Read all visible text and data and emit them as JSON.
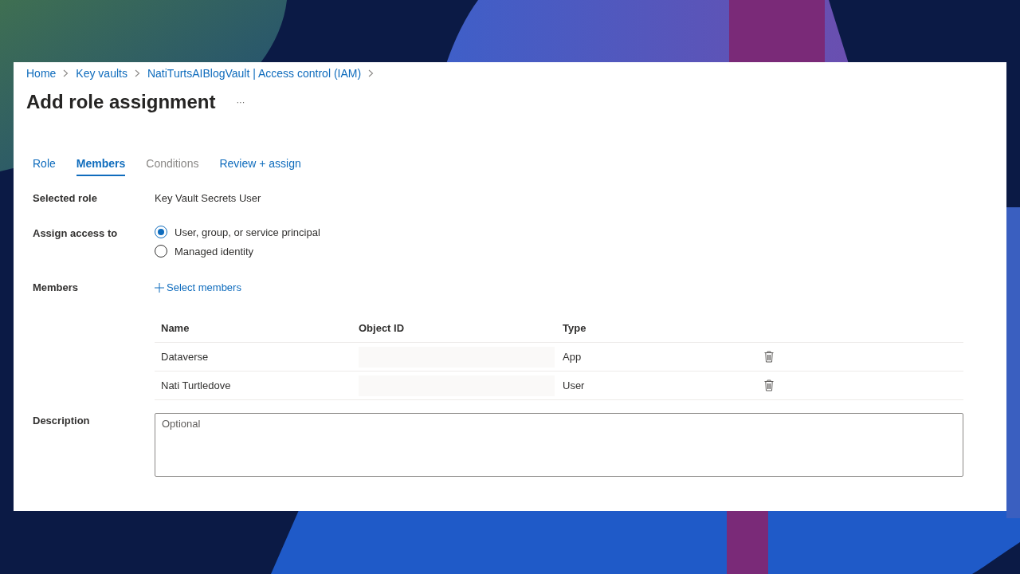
{
  "breadcrumb": [
    {
      "label": "Home"
    },
    {
      "label": "Key vaults"
    },
    {
      "label": "NatiTurtsAIBlogVault | Access control (IAM)"
    }
  ],
  "title": "Add role assignment",
  "more_button": "···",
  "tabs": [
    {
      "label": "Role",
      "selected": false,
      "disabled": false
    },
    {
      "label": "Members",
      "selected": true,
      "disabled": false
    },
    {
      "label": "Conditions",
      "selected": false,
      "disabled": true
    },
    {
      "label": "Review + assign",
      "selected": false,
      "disabled": false
    }
  ],
  "selected_role": {
    "label": "Selected role",
    "value": "Key Vault Secrets User"
  },
  "assign_access": {
    "label": "Assign access to",
    "options": [
      {
        "label": "User, group, or service principal",
        "selected": true
      },
      {
        "label": "Managed identity",
        "selected": false
      }
    ]
  },
  "members": {
    "label": "Members",
    "add_link": "Select members",
    "table": {
      "columns": [
        "Name",
        "Object ID",
        "Type"
      ],
      "rows": [
        {
          "name": "Dataverse",
          "type": "App"
        },
        {
          "name": "Nati Turtledove",
          "type": "User"
        }
      ]
    }
  },
  "description": {
    "label": "Description",
    "placeholder": "Optional"
  }
}
